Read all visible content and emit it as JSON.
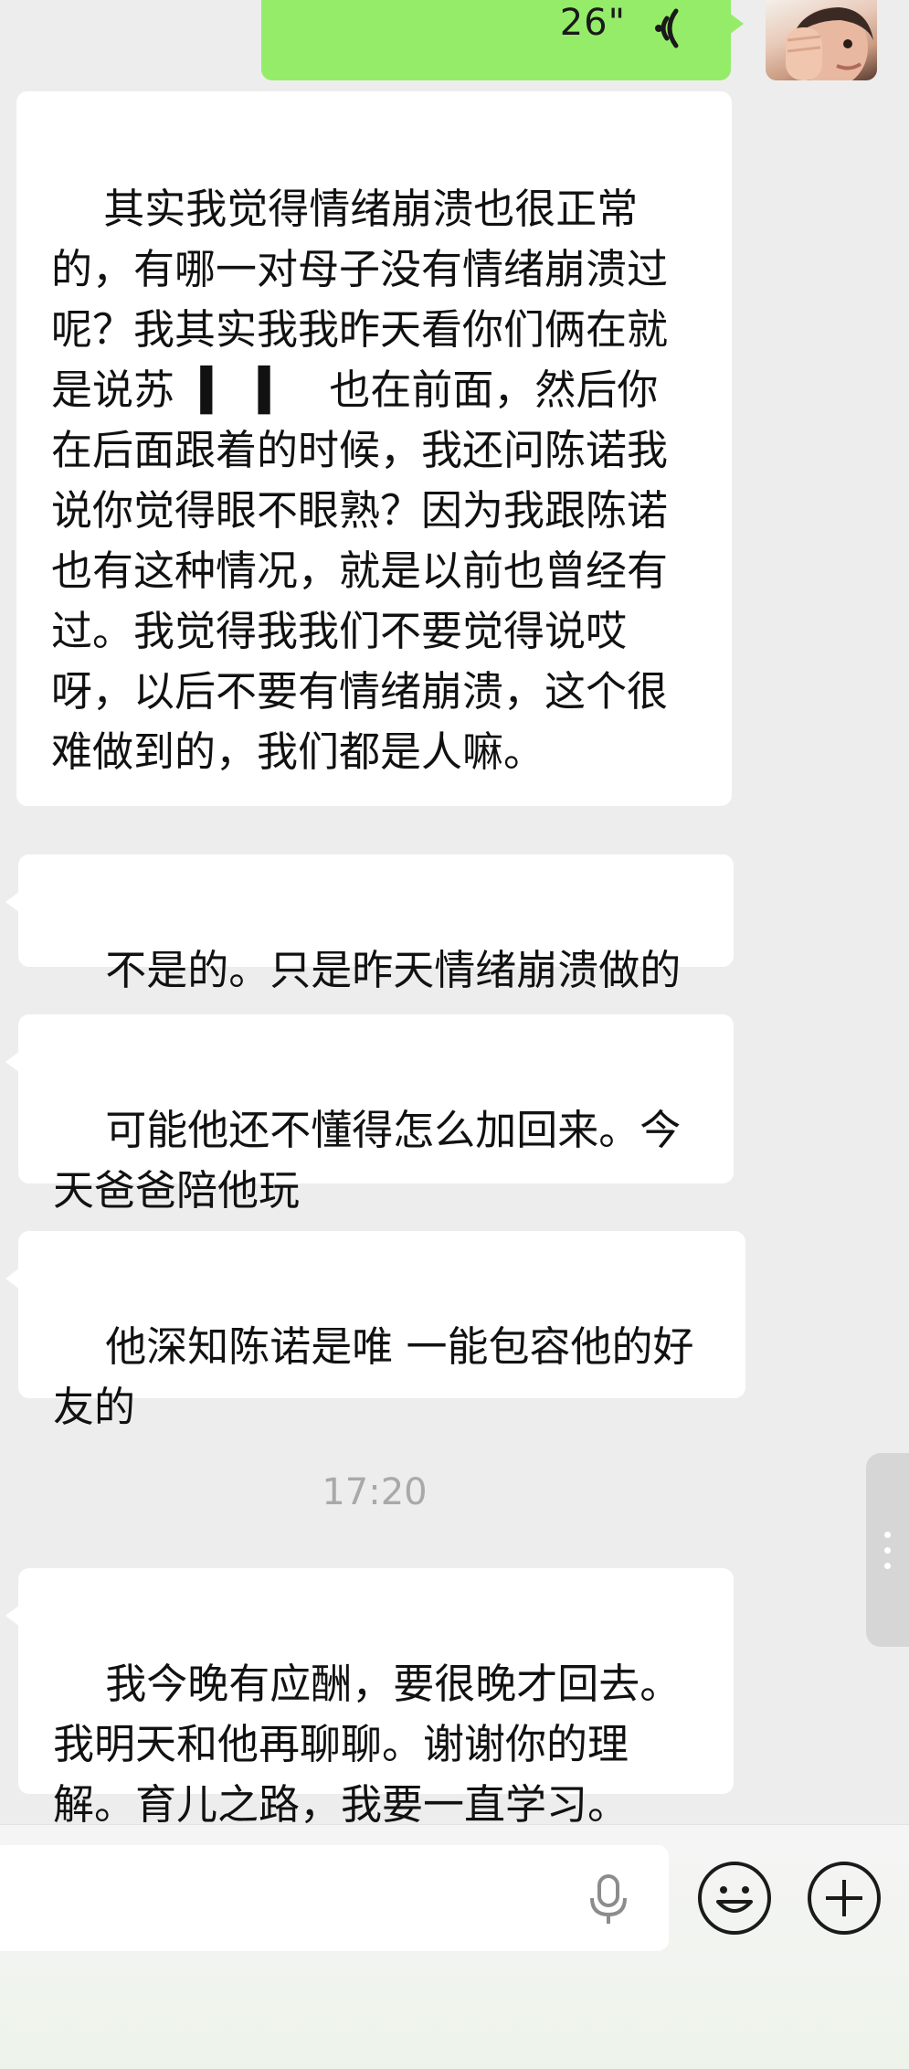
{
  "voice_message": {
    "duration": "26\""
  },
  "messages": [
    {
      "text": "其实我觉得情绪崩溃也很正常的，有哪一对母子没有情绪崩溃过呢？我其实我我昨天看你们俩在就是说苏  ▍  ▍   也在前面，然后你在后面跟着的时候，我还问陈诺我说你觉得眼不眼熟？因为我跟陈诺也有这种情况，就是以前也曾经有过。我觉得我我们不要觉得说哎呀，以后不要有情绪崩溃，这个很难做到的，我们都是人嘛。"
    },
    {
      "text": "不是的。只是昨天情绪崩溃做的"
    },
    {
      "text": "可能他还不懂得怎么加回来。今天爸爸陪他玩"
    },
    {
      "text": "他深知陈诺是唯 一能包容他的好友的"
    },
    {
      "text": "我今晚有应酬，要很晚才回去。我明天和他再聊聊。谢谢你的理解。育儿之路，我要一直学习。"
    }
  ],
  "timestamp": "17:20",
  "input": {
    "value": "",
    "placeholder": ""
  },
  "icons": {
    "voice": "voice-wave-icon",
    "mic": "microphone-icon",
    "emoji": "emoji-icon",
    "plus": "plus-icon",
    "handle": "more-dots-icon"
  },
  "colors": {
    "background": "#ededed",
    "outgoing_bubble": "#95ec69",
    "incoming_bubble": "#ffffff",
    "timestamp": "#a9a9a9"
  }
}
